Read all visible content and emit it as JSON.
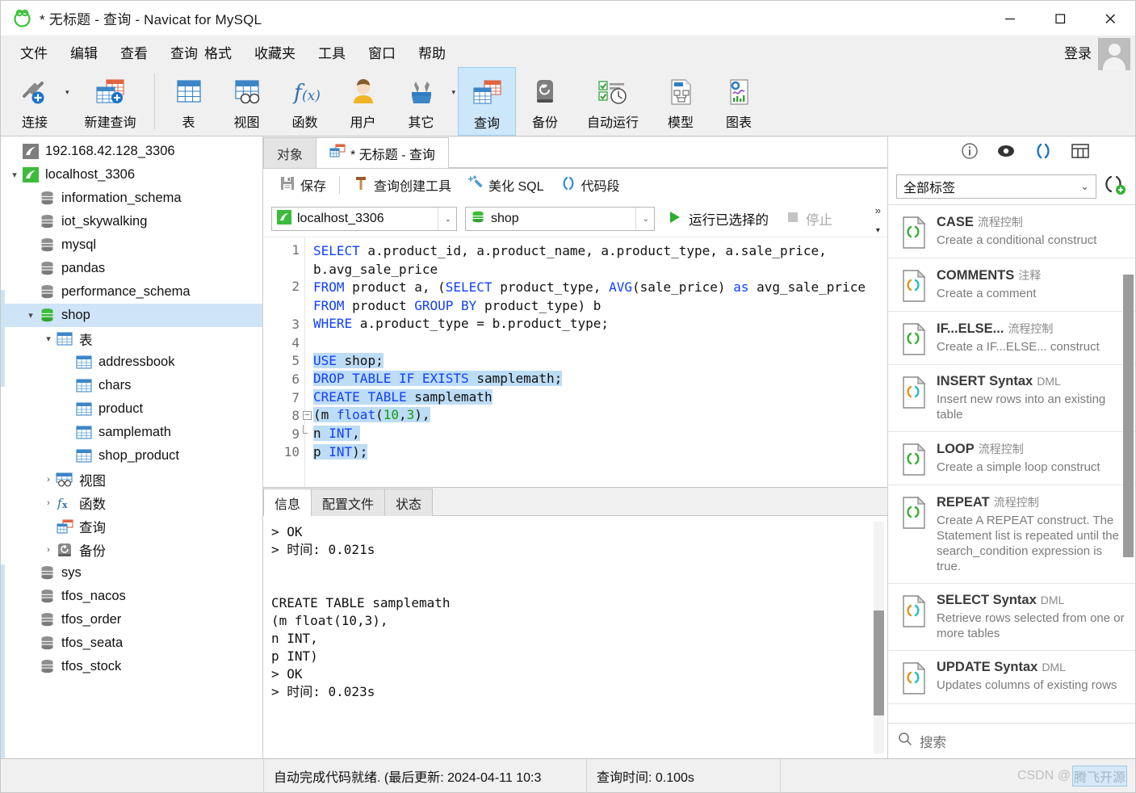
{
  "window": {
    "title": "* 无标题 - 查询 - Navicat for MySQL",
    "minimize": "–",
    "maximize": "□",
    "close": "✕"
  },
  "menubar": {
    "items": [
      "文件",
      "编辑",
      "查看",
      "查询",
      "格式",
      "收藏夹",
      "工具",
      "窗口",
      "帮助"
    ],
    "login_label": "登录"
  },
  "toolbar": {
    "buttons": [
      {
        "label": "连接",
        "icon": "connection-icon"
      },
      {
        "label": "新建查询",
        "icon": "new-query-icon"
      },
      {
        "label": "表",
        "icon": "table-icon"
      },
      {
        "label": "视图",
        "icon": "view-icon"
      },
      {
        "label": "函数",
        "icon": "function-icon"
      },
      {
        "label": "用户",
        "icon": "user-icon"
      },
      {
        "label": "其它",
        "icon": "others-icon"
      },
      {
        "label": "查询",
        "icon": "query-icon"
      },
      {
        "label": "备份",
        "icon": "backup-icon"
      },
      {
        "label": "自动运行",
        "icon": "automation-icon"
      },
      {
        "label": "模型",
        "icon": "model-icon"
      },
      {
        "label": "图表",
        "icon": "chart-icon"
      }
    ],
    "active": "查询"
  },
  "sidebar": {
    "nodes": [
      {
        "label": "192.168.42.128_3306",
        "level": 0,
        "twisty": "",
        "icon": "connection-gray-icon",
        "selected": false
      },
      {
        "label": "localhost_3306",
        "level": 0,
        "twisty": "▾",
        "icon": "connection-green-icon",
        "selected": false
      },
      {
        "label": "information_schema",
        "level": 1,
        "twisty": "",
        "icon": "database-gray-icon",
        "selected": false
      },
      {
        "label": "iot_skywalking",
        "level": 1,
        "twisty": "",
        "icon": "database-gray-icon",
        "selected": false
      },
      {
        "label": "mysql",
        "level": 1,
        "twisty": "",
        "icon": "database-gray-icon",
        "selected": false
      },
      {
        "label": "pandas",
        "level": 1,
        "twisty": "",
        "icon": "database-gray-icon",
        "selected": false
      },
      {
        "label": "performance_schema",
        "level": 1,
        "twisty": "",
        "icon": "database-gray-icon",
        "selected": false
      },
      {
        "label": "shop",
        "level": 1,
        "twisty": "▾",
        "icon": "database-green-icon",
        "selected": true
      },
      {
        "label": "表",
        "level": 2,
        "twisty": "▾",
        "icon": "tables-folder-icon",
        "selected": false
      },
      {
        "label": "addressbook",
        "level": 3,
        "twisty": "",
        "icon": "table-item-icon",
        "selected": false
      },
      {
        "label": "chars",
        "level": 3,
        "twisty": "",
        "icon": "table-item-icon",
        "selected": false
      },
      {
        "label": "product",
        "level": 3,
        "twisty": "",
        "icon": "table-item-icon",
        "selected": false
      },
      {
        "label": "samplemath",
        "level": 3,
        "twisty": "",
        "icon": "table-item-icon",
        "selected": false
      },
      {
        "label": "shop_product",
        "level": 3,
        "twisty": "",
        "icon": "table-item-icon",
        "selected": false
      },
      {
        "label": "视图",
        "level": 2,
        "twisty": "›",
        "icon": "views-folder-icon",
        "selected": false
      },
      {
        "label": "函数",
        "level": 2,
        "twisty": "›",
        "icon": "functions-folder-icon",
        "selected": false
      },
      {
        "label": "查询",
        "level": 2,
        "twisty": "",
        "icon": "queries-folder-icon",
        "selected": false
      },
      {
        "label": "备份",
        "level": 2,
        "twisty": "›",
        "icon": "backups-folder-icon",
        "selected": false
      },
      {
        "label": "sys",
        "level": 1,
        "twisty": "",
        "icon": "database-gray-icon",
        "selected": false
      },
      {
        "label": "tfos_nacos",
        "level": 1,
        "twisty": "",
        "icon": "database-gray-icon",
        "selected": false
      },
      {
        "label": "tfos_order",
        "level": 1,
        "twisty": "",
        "icon": "database-gray-icon",
        "selected": false
      },
      {
        "label": "tfos_seata",
        "level": 1,
        "twisty": "",
        "icon": "database-gray-icon",
        "selected": false
      },
      {
        "label": "tfos_stock",
        "level": 1,
        "twisty": "",
        "icon": "database-gray-icon",
        "selected": false
      }
    ]
  },
  "main": {
    "tabs": [
      {
        "label": "对象",
        "active": false,
        "icon": ""
      },
      {
        "label": "* 无标题 - 查询",
        "active": true,
        "icon": "query-tab-icon"
      }
    ],
    "query_toolbar": {
      "save": "保存",
      "query_builder": "查询创建工具",
      "beautify_sql": "美化 SQL",
      "code_snippet": "代码段"
    },
    "connection_value": "localhost_3306",
    "database_value": "shop",
    "run_label": "运行已选择的",
    "stop_label": "停止",
    "overflow_chevron": "»",
    "overflow_caret": "▾",
    "editor": {
      "line_numbers": [
        "1",
        "2",
        "3",
        "4",
        "5",
        "6",
        "7",
        "8",
        "9",
        "10"
      ],
      "lines": [
        {
          "n": 1,
          "wrapped": true
        },
        {
          "n": 2,
          "wrapped": true
        },
        {
          "n": 3,
          "wrapped": false
        },
        {
          "n": 4,
          "wrapped": false
        },
        {
          "n": 5,
          "wrapped": false
        },
        {
          "n": 6,
          "wrapped": false
        },
        {
          "n": 7,
          "wrapped": false
        },
        {
          "n": 8,
          "wrapped": false
        },
        {
          "n": 9,
          "wrapped": false
        },
        {
          "n": 10,
          "wrapped": false
        }
      ],
      "sql_text": "SELECT a.product_id, a.product_name, a.product_type, a.sale_price, b.avg_sale_price\nFROM product a, (SELECT product_type, AVG(sale_price) as avg_sale_price FROM product GROUP BY product_type) b\nWHERE a.product_type = b.product_type;\n\nUSE shop;\nDROP TABLE IF EXISTS samplemath;\nCREATE TABLE samplemath\n(m float(10,3),\nn INT,\np INT);"
    },
    "info_tabs": [
      {
        "label": "信息",
        "active": true
      },
      {
        "label": "配置文件",
        "active": false
      },
      {
        "label": "状态",
        "active": false
      }
    ],
    "results_text": "> OK\n> 时间: 0.021s\n\n\nCREATE TABLE samplemath\n(m float(10,3),\nn INT,\np INT)\n> OK\n> 时间: 0.023s"
  },
  "rightpane": {
    "icons": [
      "info-icon",
      "eye-icon",
      "parentheses-icon",
      "grid-icon"
    ],
    "filter_value": "全部标签",
    "filter_caret": "⌄",
    "add_snippet_icon": "add-snippet-icon",
    "snippets": [
      {
        "title": "CASE",
        "tag": "流程控制",
        "desc": "Create a conditional construct",
        "icon_color": "green"
      },
      {
        "title": "COMMENTS",
        "tag": "注释",
        "desc": "Create a comment",
        "icon_color": "multi"
      },
      {
        "title": "IF...ELSE...",
        "tag": "流程控制",
        "desc": "Create a IF...ELSE... construct",
        "icon_color": "green"
      },
      {
        "title": "INSERT Syntax",
        "tag": "DML",
        "desc": "Insert new rows into an existing table",
        "icon_color": "multi"
      },
      {
        "title": "LOOP",
        "tag": "流程控制",
        "desc": "Create a simple loop construct",
        "icon_color": "green"
      },
      {
        "title": "REPEAT",
        "tag": "流程控制",
        "desc": "Create A REPEAT construct. The Statement list is repeated until the search_condition expression is true.",
        "icon_color": "green"
      },
      {
        "title": "SELECT Syntax",
        "tag": "DML",
        "desc": "Retrieve rows selected from one or more tables",
        "icon_color": "multi"
      },
      {
        "title": "UPDATE Syntax",
        "tag": "DML",
        "desc": "Updates columns of existing rows",
        "icon_color": "multi"
      }
    ],
    "search_placeholder": "搜索"
  },
  "statusbar": {
    "autocomplete_status": "自动完成代码就绪. (最后更新: 2024-04-11 10:3",
    "query_time": "查询时间: 0.100s",
    "watermark_prefix": "CSDN @",
    "watermark_name": "腾飞开源"
  },
  "colors": {
    "accent": "#1a73c8",
    "selection": "#bddcf5",
    "tree_selection": "#cfe4f7",
    "keyword": "#1040ff",
    "number": "#12a012",
    "toolbar_bg": "#f0f0f0",
    "green": "#3dbb3d"
  }
}
